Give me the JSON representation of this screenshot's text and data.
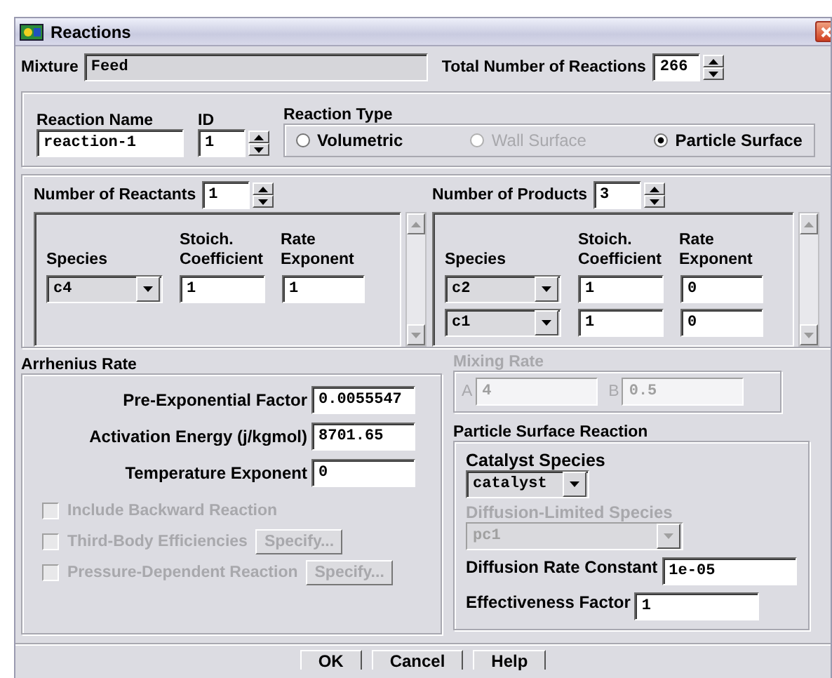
{
  "window": {
    "title": "Reactions"
  },
  "mixture": {
    "label": "Mixture",
    "value": "Feed"
  },
  "total_reactions": {
    "label": "Total Number of Reactions",
    "value": "266"
  },
  "reaction": {
    "name_label": "Reaction Name",
    "name": "reaction-1",
    "id_label": "ID",
    "id": "1",
    "type_label": "Reaction Type",
    "types": [
      {
        "label": "Volumetric",
        "selected": false,
        "disabled": false
      },
      {
        "label": "Wall Surface",
        "selected": false,
        "disabled": true
      },
      {
        "label": "Particle Surface",
        "selected": true,
        "disabled": false
      }
    ]
  },
  "reactants": {
    "count_label": "Number of Reactants",
    "count": "1",
    "columns": [
      "Species",
      "Stoich. Coefficient",
      "Rate Exponent"
    ],
    "rows": [
      {
        "species": "c4",
        "coefficient": "1",
        "exponent": "1"
      }
    ]
  },
  "products": {
    "count_label": "Number of Products",
    "count": "3",
    "columns": [
      "Species",
      "Stoich. Coefficient",
      "Rate Exponent"
    ],
    "rows": [
      {
        "species": "c2",
        "coefficient": "1",
        "exponent": "0"
      },
      {
        "species": "c1",
        "coefficient": "1",
        "exponent": "0"
      }
    ]
  },
  "arrhenius": {
    "title": "Arrhenius Rate",
    "fields": [
      {
        "label": "Pre-Exponential Factor",
        "value": "0.0055547"
      },
      {
        "label": "Activation Energy (j/kgmol)",
        "value": "8701.65"
      },
      {
        "label": "Temperature Exponent",
        "value": "0"
      }
    ],
    "options": [
      {
        "label": "Include Backward Reaction",
        "checked": false,
        "disabled": true
      },
      {
        "label": "Third-Body Efficiencies",
        "checked": false,
        "disabled": true,
        "button": "Specify..."
      },
      {
        "label": "Pressure-Dependent Reaction",
        "checked": false,
        "disabled": true,
        "button": "Specify..."
      }
    ]
  },
  "mixing_rate": {
    "title": "Mixing Rate",
    "disabled": true,
    "fields": [
      {
        "label": "A",
        "value": "4"
      },
      {
        "label": "B",
        "value": "0.5"
      }
    ]
  },
  "particle_surface": {
    "title": "Particle Surface Reaction",
    "catalyst_label": "Catalyst Species",
    "catalyst": "catalyst",
    "diffusion_species_label": "Diffusion-Limited Species",
    "diffusion_species": "pc1",
    "diffusion_species_disabled": true,
    "fields": [
      {
        "label": "Diffusion Rate Constant",
        "value": "1e-05"
      },
      {
        "label": "Effectiveness Factor",
        "value": "1"
      }
    ]
  },
  "buttons": [
    "OK",
    "Cancel",
    "Help"
  ]
}
